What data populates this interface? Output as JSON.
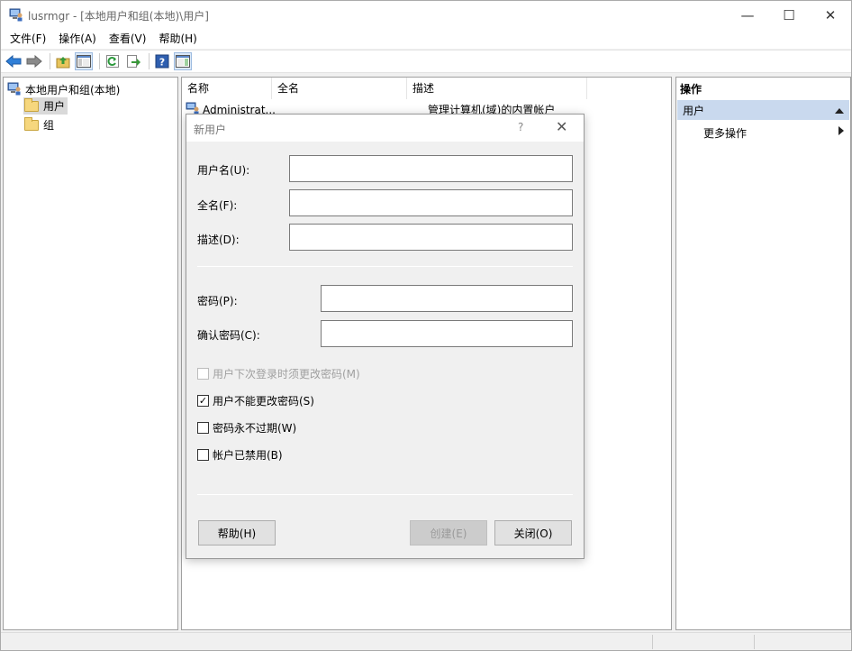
{
  "window": {
    "title": "lusrmgr - [本地用户和组(本地)\\用户]",
    "minimize_glyph": "—",
    "maximize_glyph": "☐",
    "close_glyph": "✕"
  },
  "menu": [
    "文件(F)",
    "操作(A)",
    "查看(V)",
    "帮助(H)"
  ],
  "toolbar": {
    "icons": [
      "back-icon",
      "forward-icon",
      "up-folder-icon",
      "show-tree-icon",
      "refresh-icon",
      "export-icon",
      "help-icon",
      "show-action-pane-icon"
    ],
    "help_glyph": "?"
  },
  "tree": {
    "root_label": "本地用户和组(本地)",
    "children": [
      {
        "label": "用户",
        "selected": true
      },
      {
        "label": "组",
        "selected": false
      }
    ]
  },
  "list": {
    "columns": [
      "名称",
      "全名",
      "描述"
    ],
    "rows": [
      {
        "name": "Administrat...",
        "fullname": "",
        "description": "管理计算机(域)的内置帐户"
      }
    ]
  },
  "actions": {
    "title": "操作",
    "group": "用户",
    "item": "更多操作"
  },
  "dialog": {
    "title": "新用户",
    "help_glyph": "?",
    "close_glyph": "✕",
    "username_label": "用户名(U):",
    "username_value": "",
    "fullname_label": "全名(F):",
    "fullname_value": "",
    "description_label": "描述(D):",
    "description_value": "",
    "password_label": "密码(P):",
    "confirm_label": "确认密码(C):",
    "checkboxes": [
      {
        "label": "用户下次登录时须更改密码(M)",
        "checked": false,
        "disabled": true
      },
      {
        "label": "用户不能更改密码(S)",
        "checked": true,
        "disabled": false
      },
      {
        "label": "密码永不过期(W)",
        "checked": false,
        "disabled": false
      },
      {
        "label": "帐户已禁用(B)",
        "checked": false,
        "disabled": false
      }
    ],
    "help_button": "帮助(H)",
    "create_button": "创建(E)",
    "close_button": "关闭(O)"
  }
}
